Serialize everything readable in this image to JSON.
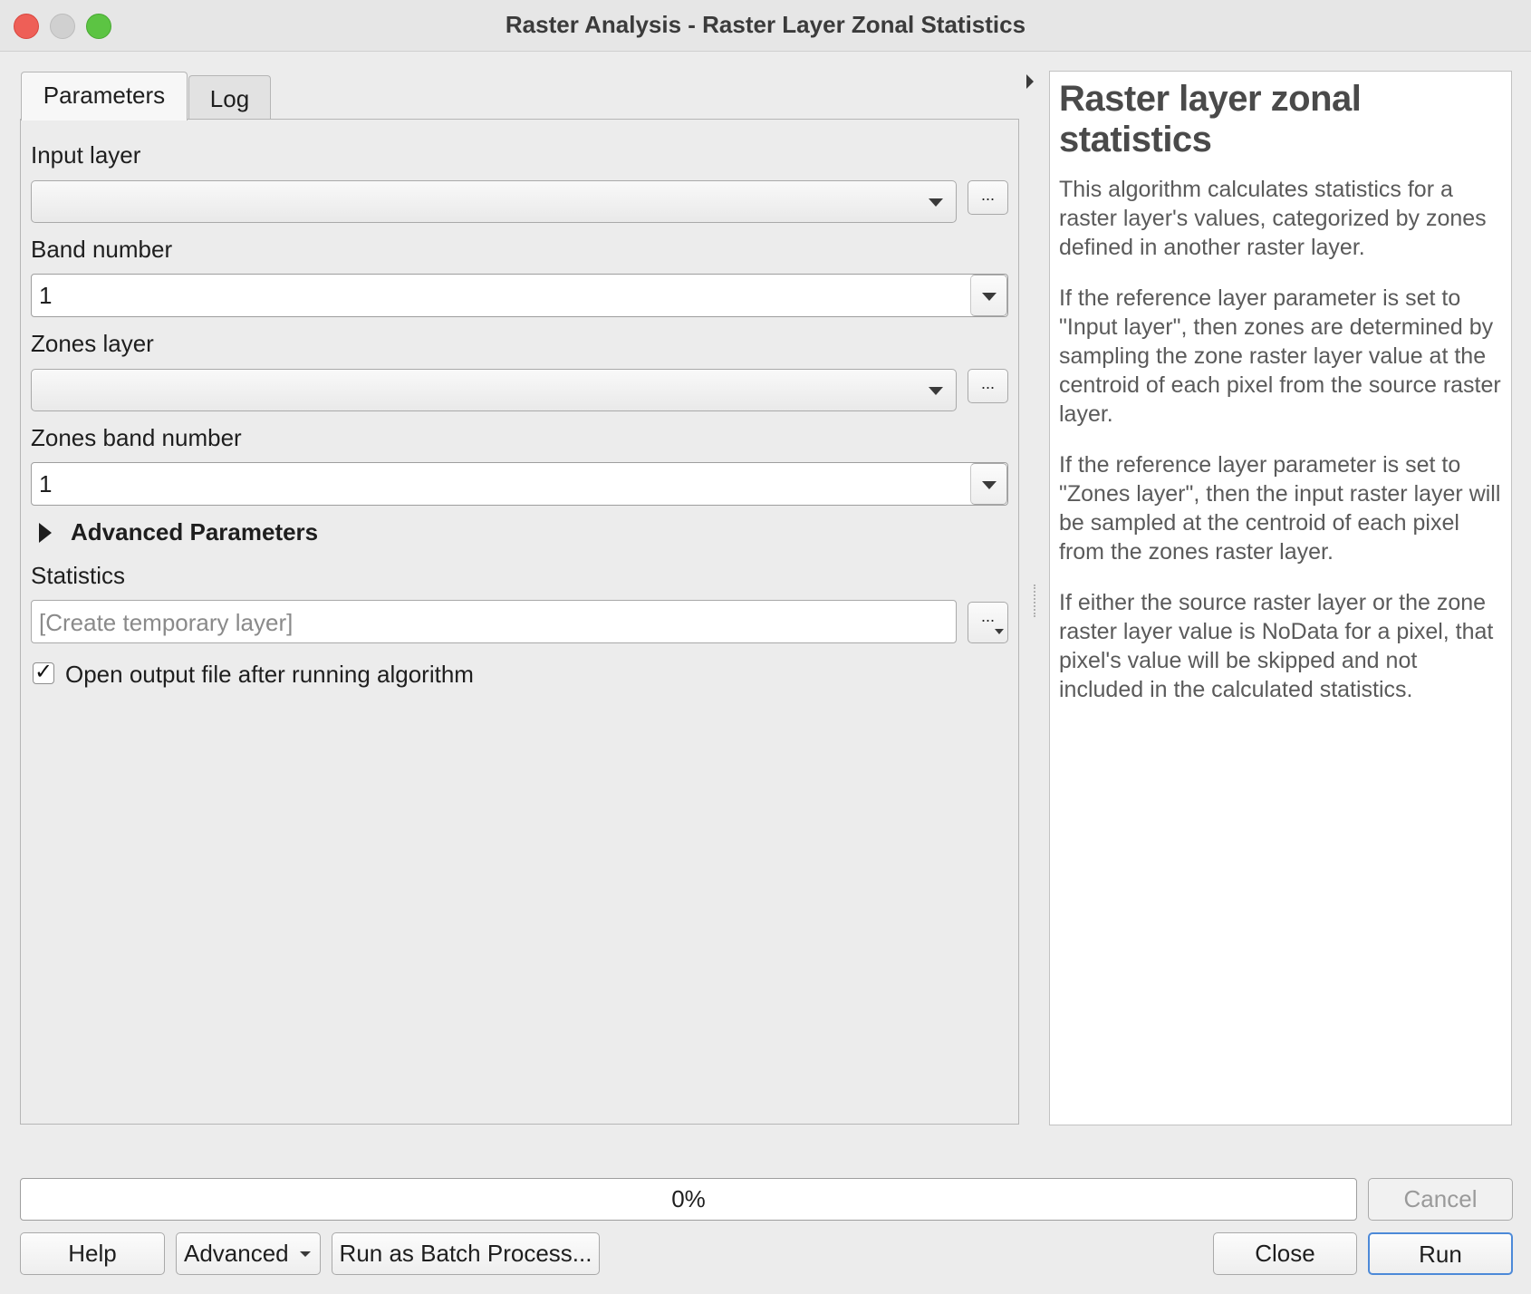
{
  "window": {
    "title": "Raster Analysis - Raster Layer Zonal Statistics"
  },
  "tabs": [
    {
      "label": "Parameters",
      "active": true
    },
    {
      "label": "Log",
      "active": false
    }
  ],
  "params": {
    "input_layer_label": "Input layer",
    "input_layer_value": "",
    "band_number_label": "Band number",
    "band_number_value": "1",
    "zones_layer_label": "Zones layer",
    "zones_layer_value": "",
    "zones_band_label": "Zones band number",
    "zones_band_value": "1",
    "advanced_label": "Advanced Parameters",
    "statistics_label": "Statistics",
    "statistics_placeholder": "[Create temporary layer]",
    "browse_label": "...",
    "open_output_label": "Open output file after running algorithm",
    "open_output_checked": true,
    "check_glyph": "✓"
  },
  "help": {
    "title": "Raster layer zonal statistics",
    "paragraphs": [
      "This algorithm calculates statistics for a raster layer's values, categorized by zones defined in another raster layer.",
      "If the reference layer parameter is set to \"Input layer\", then zones are determined by sampling the zone raster layer value at the centroid of each pixel from the source raster layer.",
      "If the reference layer parameter is set to \"Zones layer\", then the input raster layer will be sampled at the centroid of each pixel from the zones raster layer.",
      "If either the source raster layer or the zone raster layer value is NoData for a pixel, that pixel's value will be skipped and not included in the calculated statistics."
    ]
  },
  "progress": {
    "value_text": "0%"
  },
  "buttons": {
    "cancel": "Cancel",
    "help": "Help",
    "advanced": "Advanced",
    "batch": "Run as Batch Process...",
    "close": "Close",
    "run": "Run"
  },
  "colors": {
    "traffic_close": "#ee5f57",
    "traffic_minimize": "#d0d0d0",
    "traffic_maximize": "#5cc443",
    "run_button_border": "#4c89d8"
  },
  "icons": {
    "window_close": "close-icon",
    "window_minimize": "minimize-icon",
    "window_maximize": "maximize-icon",
    "dropdown": "chevron-down-icon",
    "expander": "triangle-right-icon",
    "panel_toggle": "chevron-right-icon"
  }
}
